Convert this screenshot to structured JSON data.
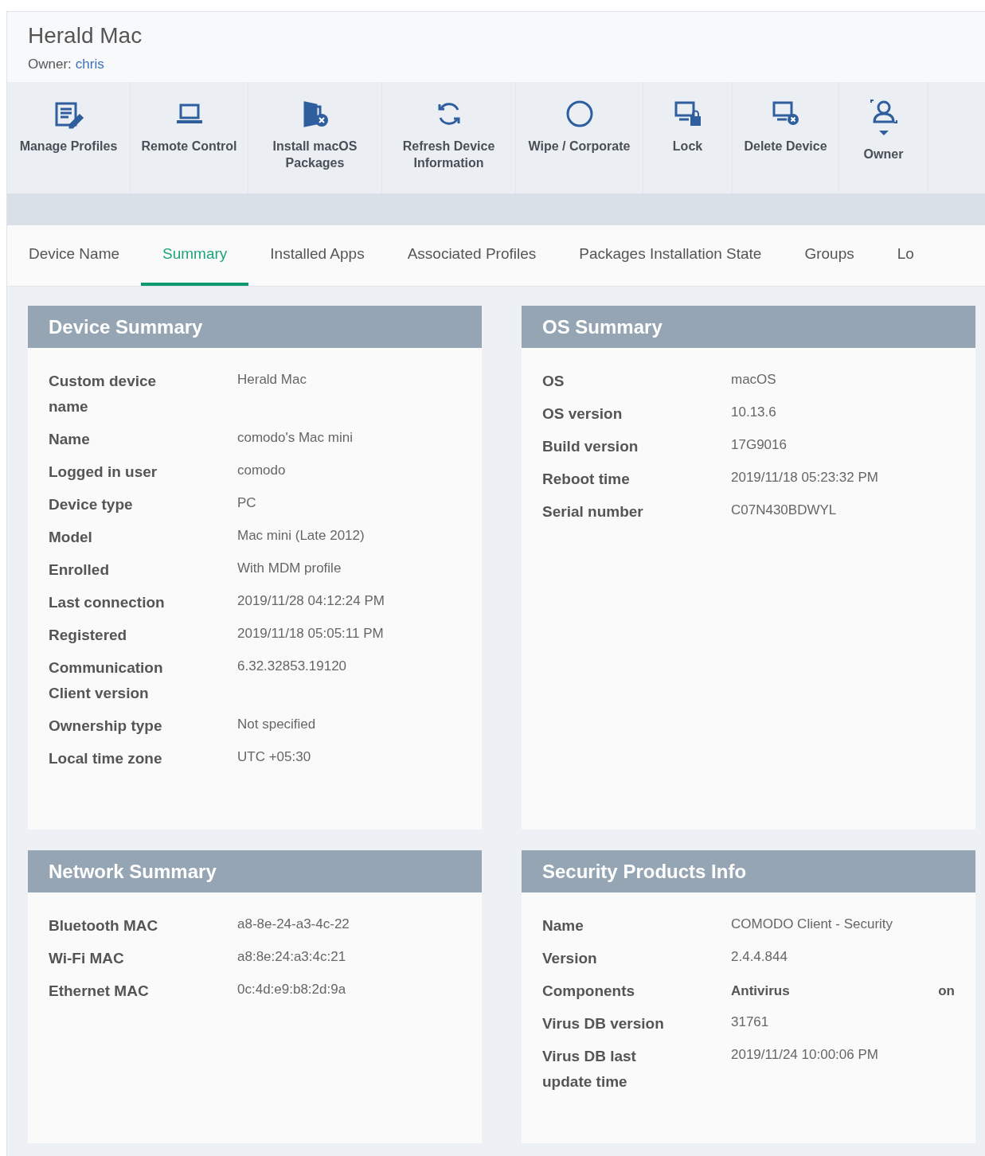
{
  "device": {
    "title": "Herald Mac",
    "owner_label": "Owner:",
    "owner": "chris"
  },
  "toolbar": [
    {
      "kind": "profiles",
      "label": "Manage Profiles"
    },
    {
      "kind": "remote",
      "label": "Remote Control"
    },
    {
      "kind": "install",
      "label": "Install macOS Packages"
    },
    {
      "kind": "refresh",
      "label": "Refresh Device Information"
    },
    {
      "kind": "wipe",
      "label": "Wipe / Corporate"
    },
    {
      "kind": "lock",
      "label": "Lock"
    },
    {
      "kind": "delete",
      "label": "Delete Device"
    },
    {
      "kind": "owner",
      "label": "Owner"
    }
  ],
  "tabs": [
    {
      "label": "Device Name",
      "selected": false
    },
    {
      "label": "Summary",
      "selected": true
    },
    {
      "label": "Installed Apps",
      "selected": false
    },
    {
      "label": "Associated Profiles",
      "selected": false
    },
    {
      "label": "Packages Installation State",
      "selected": false
    },
    {
      "label": "Groups",
      "selected": false
    },
    {
      "label": "Lo",
      "selected": false
    }
  ],
  "panels": [
    {
      "title": "Device Summary",
      "rows": [
        {
          "kind": "text",
          "label": "Custom device name",
          "value": "Herald Mac"
        },
        {
          "kind": "text",
          "label": "Name",
          "value": "comodo's Mac mini"
        },
        {
          "kind": "text",
          "label": "Logged in user",
          "value": "comodo"
        },
        {
          "kind": "text",
          "label": "Device type",
          "value": "PC"
        },
        {
          "kind": "text",
          "label": "Model",
          "value": "Mac mini (Late 2012)"
        },
        {
          "kind": "text",
          "label": "Enrolled",
          "value": "With MDM profile"
        },
        {
          "kind": "text",
          "label": "Last connection",
          "value": "2019/11/28 04:12:24 PM"
        },
        {
          "kind": "text",
          "label": "Registered",
          "value": "2019/11/18 05:05:11 PM"
        },
        {
          "kind": "text",
          "label": "Communication Client version",
          "value": "6.32.32853.19120"
        },
        {
          "kind": "text",
          "label": "Ownership type",
          "value": "Not specified"
        },
        {
          "kind": "text",
          "label": "Local time zone",
          "value": "UTC +05:30"
        }
      ]
    },
    {
      "title": "OS Summary",
      "rows": [
        {
          "kind": "text",
          "label": "OS",
          "value": "macOS"
        },
        {
          "kind": "text",
          "label": "OS version",
          "value": "10.13.6"
        },
        {
          "kind": "text",
          "label": "Build version",
          "value": "17G9016"
        },
        {
          "kind": "text",
          "label": "Reboot time",
          "value": "2019/11/18 05:23:32 PM"
        },
        {
          "kind": "text",
          "label": "Serial number",
          "value": "C07N430BDWYL"
        }
      ]
    },
    {
      "title": "Network Summary",
      "rows": [
        {
          "kind": "text",
          "label": "Bluetooth MAC",
          "value": "a8-8e-24-a3-4c-22"
        },
        {
          "kind": "text",
          "label": "Wi-Fi MAC",
          "value": "a8:8e:24:a3:4c:21"
        },
        {
          "kind": "text",
          "label": "Ethernet MAC",
          "value": "0c:4d:e9:b8:2d:9a"
        }
      ]
    },
    {
      "title": "Security Products Info",
      "rows": [
        {
          "kind": "text",
          "label": "Name",
          "value": "COMODO Client - Security"
        },
        {
          "kind": "text",
          "label": "Version",
          "value": "2.4.4.844"
        },
        {
          "kind": "component",
          "label": "Components",
          "value": "Antivirus",
          "state": "on"
        },
        {
          "kind": "text",
          "label": "Virus DB version",
          "value": "31761"
        },
        {
          "kind": "text",
          "label": "Virus DB last update time",
          "value": "2019/11/24 10:00:06 PM"
        }
      ]
    }
  ]
}
